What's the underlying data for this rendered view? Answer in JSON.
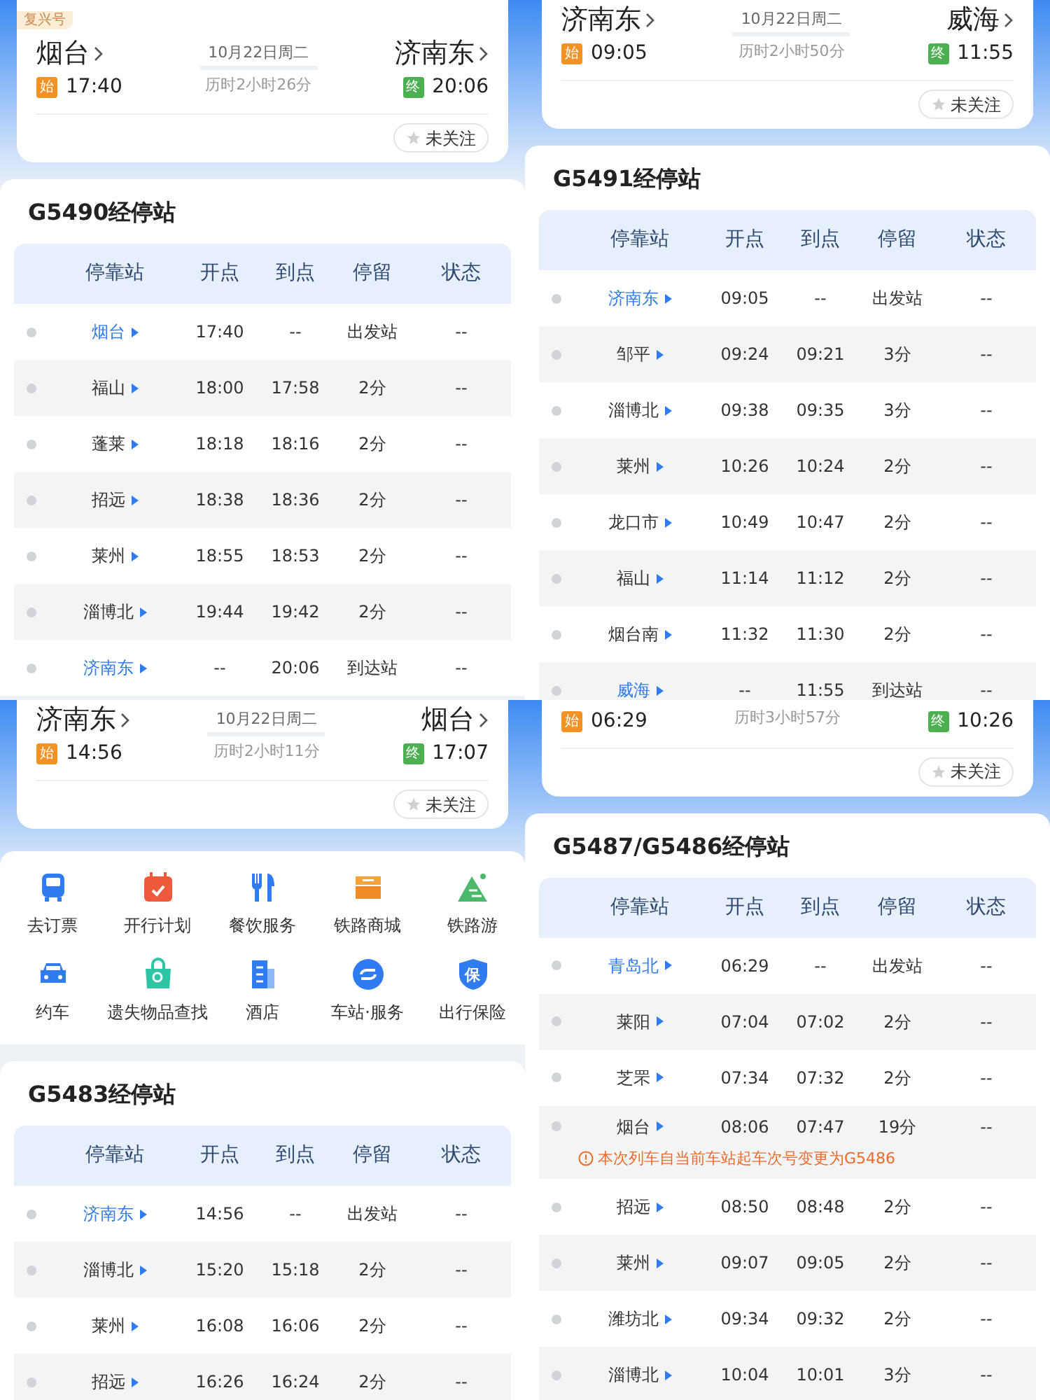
{
  "panels": [
    {
      "train_card": {
        "tag": "复兴号",
        "from": {
          "station": "烟台",
          "time": "17:40",
          "badge": "始",
          "color": "#f39224"
        },
        "to": {
          "station": "济南东",
          "time": "20:06",
          "badge": "终",
          "color": "#4cb050"
        },
        "date": "10月22日周二",
        "duration": "历时2小时26分",
        "follow": {
          "label": "未关注",
          "followed": false
        }
      },
      "stops": {
        "title": "G5490经停站",
        "columns": [
          "停靠站",
          "开点",
          "到点",
          "停留",
          "状态"
        ],
        "rows": [
          {
            "station": "烟台",
            "depart": "17:40",
            "arrive": "--",
            "stay": "出发站",
            "status": "--",
            "highlighted": true
          },
          {
            "station": "福山",
            "depart": "18:00",
            "arrive": "17:58",
            "stay": "2分",
            "status": "--",
            "highlighted": false
          },
          {
            "station": "蓬莱",
            "depart": "18:18",
            "arrive": "18:16",
            "stay": "2分",
            "status": "--",
            "highlighted": false
          },
          {
            "station": "招远",
            "depart": "18:38",
            "arrive": "18:36",
            "stay": "2分",
            "status": "--",
            "highlighted": false
          },
          {
            "station": "莱州",
            "depart": "18:55",
            "arrive": "18:53",
            "stay": "2分",
            "status": "--",
            "highlighted": false
          },
          {
            "station": "淄博北",
            "depart": "19:44",
            "arrive": "19:42",
            "stay": "2分",
            "status": "--",
            "highlighted": false
          },
          {
            "station": "济南东",
            "depart": "--",
            "arrive": "20:06",
            "stay": "到达站",
            "status": "--",
            "highlighted": true
          }
        ]
      }
    },
    {
      "train_card": {
        "from": {
          "station": "济南东",
          "time": "09:05",
          "badge": "始",
          "color": "#f39224"
        },
        "to": {
          "station": "威海",
          "time": "11:55",
          "badge": "终",
          "color": "#4cb050"
        },
        "date": "10月22日周二",
        "duration": "历时2小时50分",
        "follow": {
          "label": "未关注",
          "followed": false
        }
      },
      "stops": {
        "title": "G5491经停站",
        "columns": [
          "停靠站",
          "开点",
          "到点",
          "停留",
          "状态"
        ],
        "rows": [
          {
            "station": "济南东",
            "depart": "09:05",
            "arrive": "--",
            "stay": "出发站",
            "status": "--",
            "highlighted": true
          },
          {
            "station": "邹平",
            "depart": "09:24",
            "arrive": "09:21",
            "stay": "3分",
            "status": "--",
            "highlighted": false
          },
          {
            "station": "淄博北",
            "depart": "09:38",
            "arrive": "09:35",
            "stay": "3分",
            "status": "--",
            "highlighted": false
          },
          {
            "station": "莱州",
            "depart": "10:26",
            "arrive": "10:24",
            "stay": "2分",
            "status": "--",
            "highlighted": false
          },
          {
            "station": "龙口市",
            "depart": "10:49",
            "arrive": "10:47",
            "stay": "2分",
            "status": "--",
            "highlighted": false
          },
          {
            "station": "福山",
            "depart": "11:14",
            "arrive": "11:12",
            "stay": "2分",
            "status": "--",
            "highlighted": false
          },
          {
            "station": "烟台南",
            "depart": "11:32",
            "arrive": "11:30",
            "stay": "2分",
            "status": "--",
            "highlighted": false
          },
          {
            "station": "威海",
            "depart": "--",
            "arrive": "11:55",
            "stay": "到达站",
            "status": "--",
            "highlighted": true
          }
        ]
      }
    },
    {
      "train_card": {
        "from": {
          "station": "济南东",
          "time": "14:56",
          "badge": "始",
          "color": "#f39224"
        },
        "to": {
          "station": "烟台",
          "time": "17:07",
          "badge": "终",
          "color": "#4cb050"
        },
        "date": "10月22日周二",
        "duration": "历时2小时11分",
        "follow": {
          "label": "未关注",
          "followed": false
        }
      },
      "services": [
        {
          "label": "去订票",
          "kind": "train"
        },
        {
          "label": "开行计划",
          "kind": "calendar"
        },
        {
          "label": "餐饮服务",
          "kind": "dining"
        },
        {
          "label": "铁路商城",
          "kind": "shop"
        },
        {
          "label": "铁路游",
          "kind": "mountain"
        },
        {
          "label": "约车",
          "kind": "car"
        },
        {
          "label": "遗失物品查找",
          "kind": "bag"
        },
        {
          "label": "酒店",
          "kind": "building"
        },
        {
          "label": "车站·服务",
          "kind": "loop"
        },
        {
          "label": "出行保险",
          "kind": "shield",
          "glyph": "保"
        }
      ],
      "stops": {
        "title": "G5483经停站",
        "columns": [
          "停靠站",
          "开点",
          "到点",
          "停留",
          "状态"
        ],
        "rows": [
          {
            "station": "济南东",
            "depart": "14:56",
            "arrive": "--",
            "stay": "出发站",
            "status": "--",
            "highlighted": true
          },
          {
            "station": "淄博北",
            "depart": "15:20",
            "arrive": "15:18",
            "stay": "2分",
            "status": "--",
            "highlighted": false
          },
          {
            "station": "莱州",
            "depart": "16:08",
            "arrive": "16:06",
            "stay": "2分",
            "status": "--",
            "highlighted": false
          },
          {
            "station": "招远",
            "depart": "16:26",
            "arrive": "16:24",
            "stay": "2分",
            "status": "--",
            "highlighted": false
          }
        ]
      }
    },
    {
      "train_card": {
        "from": {
          "time": "06:29",
          "badge": "始",
          "color": "#f39224"
        },
        "to": {
          "time": "10:26",
          "badge": "终",
          "color": "#4cb050"
        },
        "duration": "历时3小时57分",
        "follow": {
          "label": "未关注",
          "followed": false
        }
      },
      "stops": {
        "title": "G5487/G5486经停站",
        "columns": [
          "停靠站",
          "开点",
          "到点",
          "停留",
          "状态"
        ],
        "rows": [
          {
            "station": "青岛北",
            "depart": "06:29",
            "arrive": "--",
            "stay": "出发站",
            "status": "--",
            "highlighted": true
          },
          {
            "station": "莱阳",
            "depart": "07:04",
            "arrive": "07:02",
            "stay": "2分",
            "status": "--",
            "highlighted": false
          },
          {
            "station": "芝罘",
            "depart": "07:34",
            "arrive": "07:32",
            "stay": "2分",
            "status": "--",
            "highlighted": false
          },
          {
            "station": "烟台",
            "depart": "08:06",
            "arrive": "07:47",
            "stay": "19分",
            "status": "--",
            "highlighted": false,
            "note": "本次列车自当前车站起车次号变更为G5486"
          },
          {
            "station": "招远",
            "depart": "08:50",
            "arrive": "08:48",
            "stay": "2分",
            "status": "--",
            "highlighted": false
          },
          {
            "station": "莱州",
            "depart": "09:07",
            "arrive": "09:05",
            "stay": "2分",
            "status": "--",
            "highlighted": false
          },
          {
            "station": "潍坊北",
            "depart": "09:34",
            "arrive": "09:32",
            "stay": "2分",
            "status": "--",
            "highlighted": false
          },
          {
            "station": "淄博北",
            "depart": "10:04",
            "arrive": "10:01",
            "stay": "3分",
            "status": "--",
            "highlighted": false
          }
        ]
      }
    }
  ]
}
